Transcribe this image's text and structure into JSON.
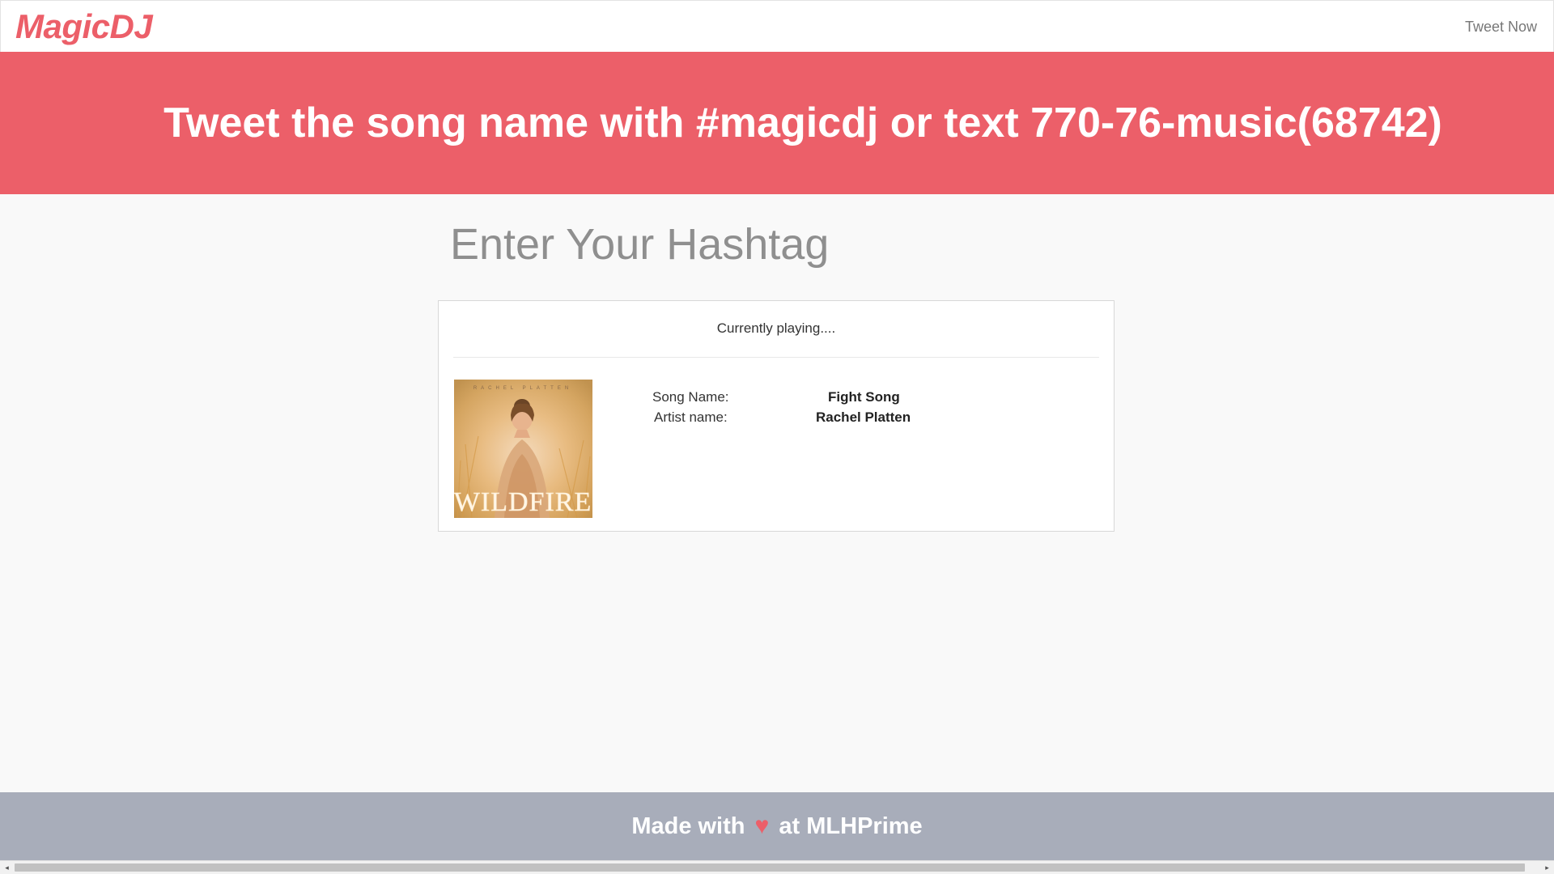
{
  "navbar": {
    "brand": "MagicDJ",
    "link": "Tweet Now"
  },
  "banner": {
    "text": "Tweet the song name with #magicdj or text 770-76-music(68742)"
  },
  "hashtag": {
    "title": "Enter Your Hashtag"
  },
  "now_playing": {
    "header": "Currently playing....",
    "song_label": "Song Name:",
    "song_value": "Fight Song",
    "artist_label": "Artist name:",
    "artist_value": "Rachel Platten",
    "album_art": {
      "artist_text": "RACHEL PLATTEN",
      "title_text": "WILDFIRE"
    }
  },
  "footer": {
    "prefix": "Made with",
    "heart": "♥",
    "suffix": "at MLHPrime"
  },
  "colors": {
    "accent": "#ec5f69",
    "footer_bg": "#a8adba",
    "page_bg": "#f9f9f9"
  },
  "icons": [
    "heart-icon",
    "scroll-left-arrow-icon",
    "scroll-right-arrow-icon"
  ]
}
